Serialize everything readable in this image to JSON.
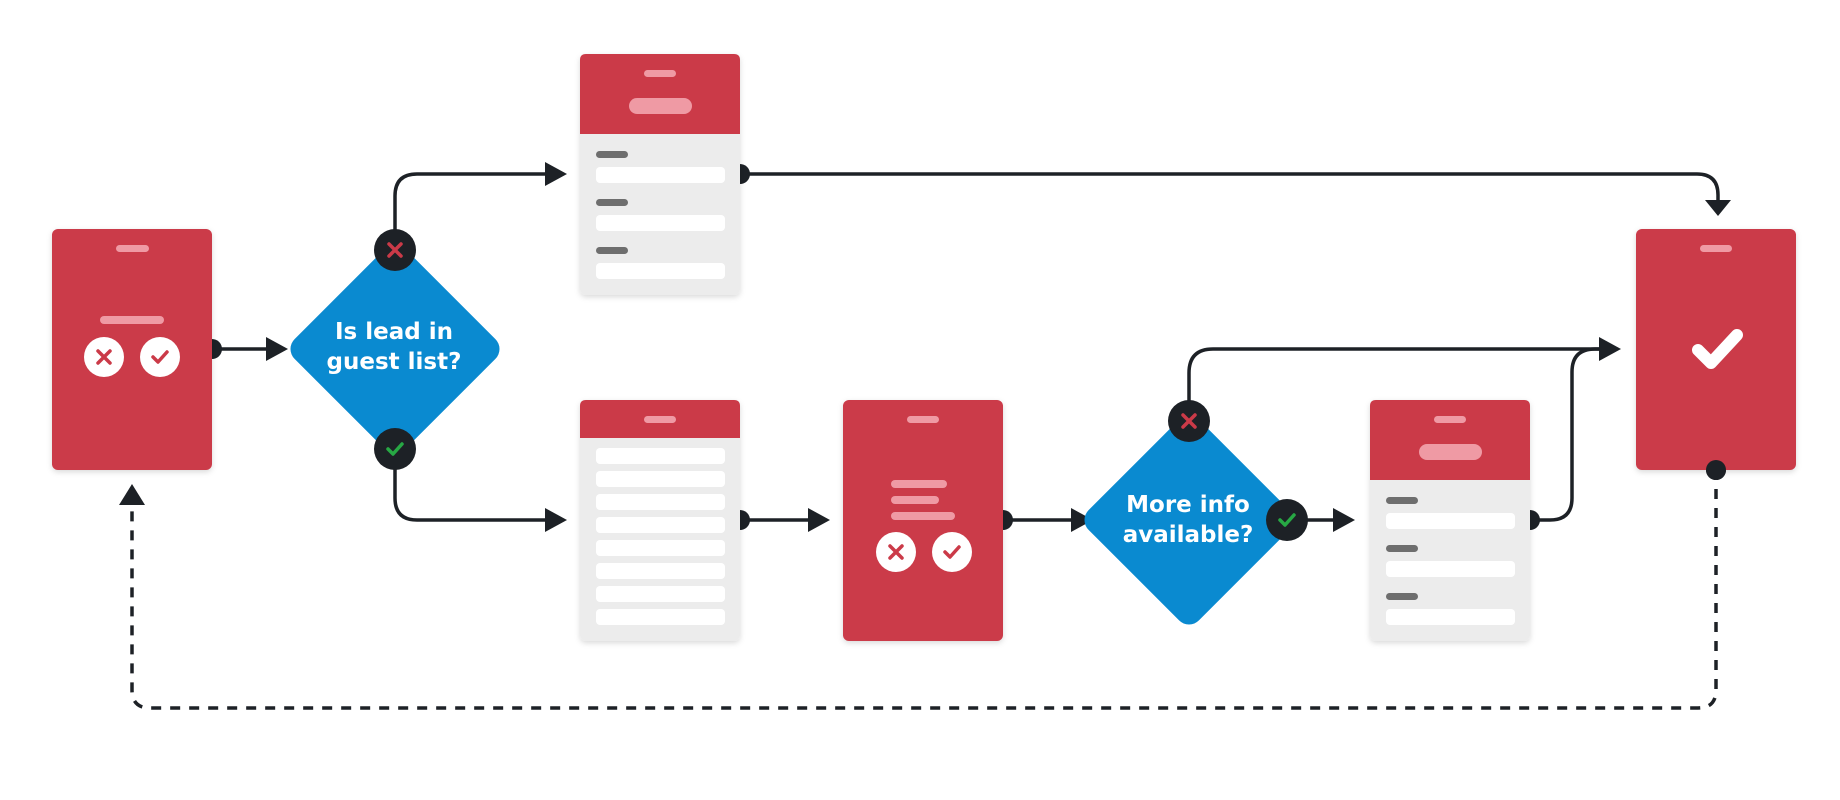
{
  "decisions": {
    "lead_check": {
      "line1": "Is lead in",
      "line2": "guest list?"
    },
    "info_check": {
      "line1": "More info",
      "line2": "available?"
    }
  },
  "colors": {
    "red": "#cb3a48",
    "blue": "#0a8ad0",
    "connector": "#1d2126",
    "card_bg": "#ececec",
    "field": "#ffffff",
    "label_bar": "#6e6e6e",
    "pill_light": "#ef9aa4",
    "check_green": "#27a844"
  },
  "icons": {
    "yes": "check-icon",
    "no": "close-icon",
    "done": "check-icon"
  }
}
